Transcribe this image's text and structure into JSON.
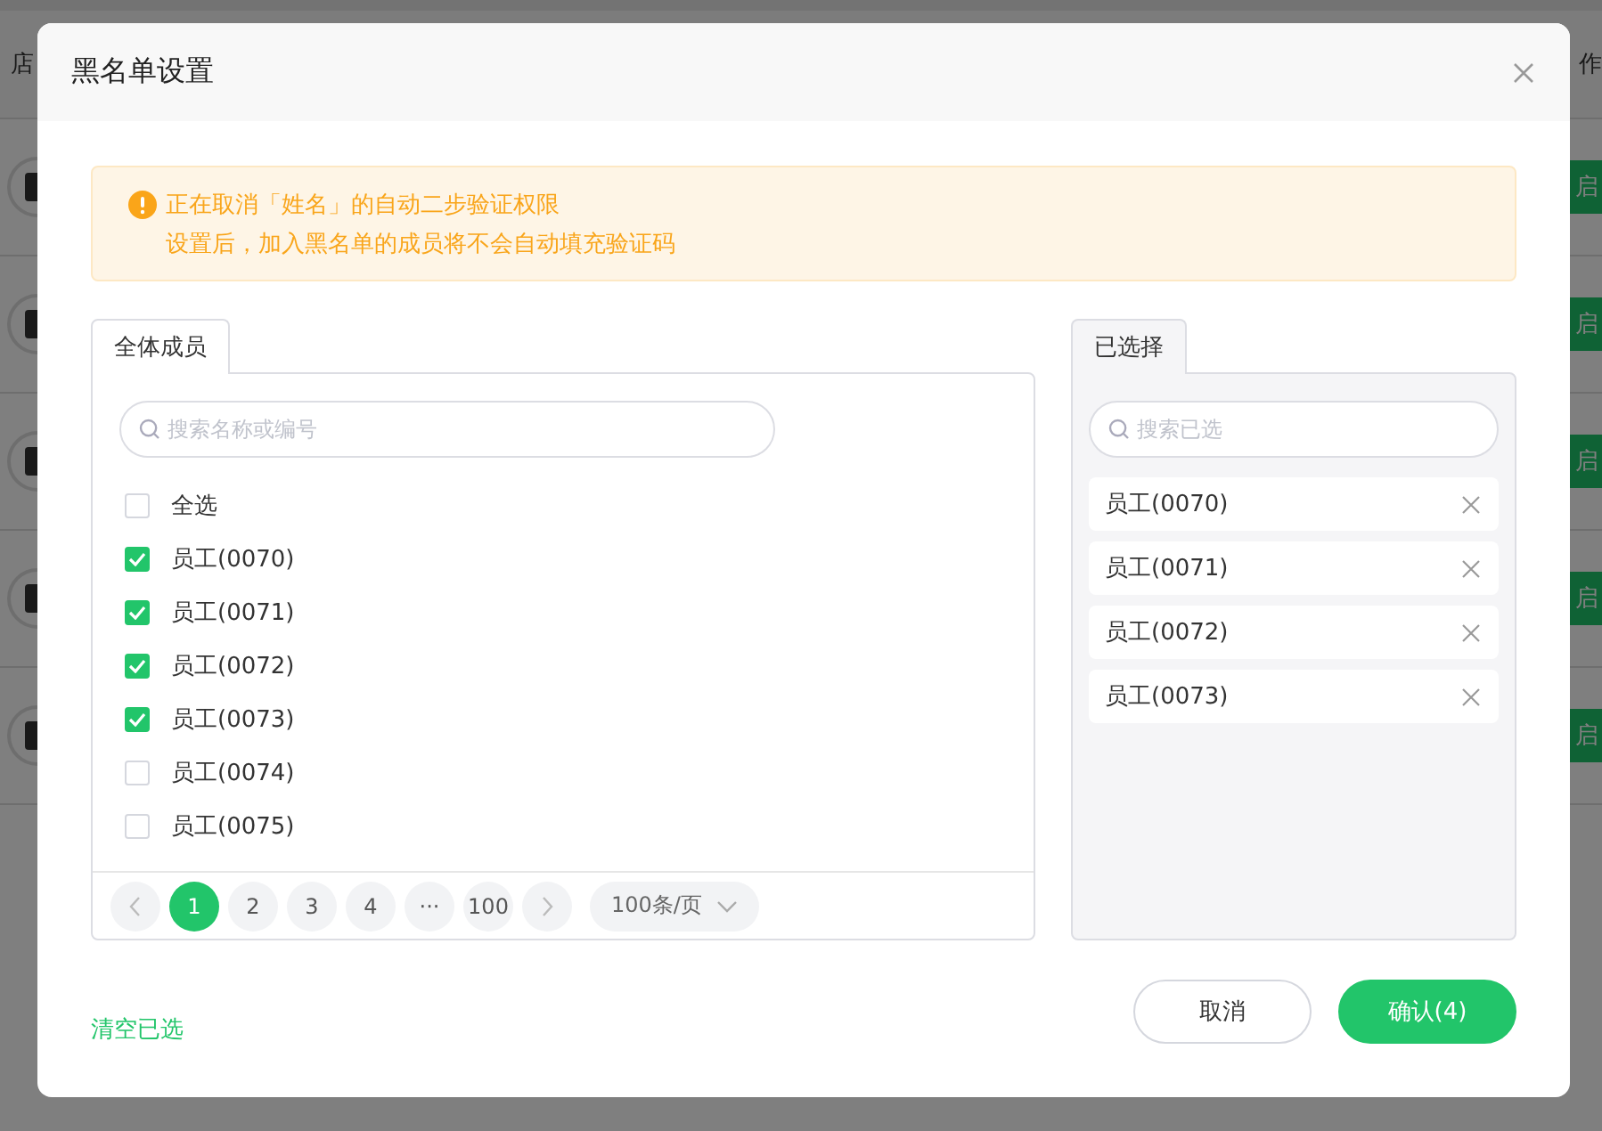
{
  "page": {
    "columns": [
      "店",
      "作"
    ],
    "rows": [
      {
        "action": "启"
      },
      {
        "action": "启"
      },
      {
        "action": "启"
      },
      {
        "action": "启"
      },
      {
        "action": "启"
      }
    ]
  },
  "dialog": {
    "title": "黑名单设置",
    "alert": {
      "title": "正在取消「姓名」的自动二步验证权限",
      "text": "设置后，加入黑名单的成员将不会自动填充验证码"
    },
    "left": {
      "tab": "全体成员",
      "search": {
        "placeholder": "搜索名称或编号"
      },
      "select_all": {
        "label": "全选",
        "checked": false
      },
      "members": [
        {
          "label": "员工(0070)",
          "checked": true
        },
        {
          "label": "员工(0071)",
          "checked": true
        },
        {
          "label": "员工(0072)",
          "checked": true
        },
        {
          "label": "员工(0073)",
          "checked": true
        },
        {
          "label": "员工(0074)",
          "checked": false
        },
        {
          "label": "员工(0075)",
          "checked": false
        }
      ],
      "pagination": {
        "pages": [
          {
            "label": "1",
            "selected": true
          },
          {
            "label": "2",
            "selected": false
          },
          {
            "label": "3",
            "selected": false
          },
          {
            "label": "4",
            "selected": false
          },
          {
            "label": "···",
            "selected": false
          },
          {
            "label": "100",
            "selected": false
          }
        ],
        "page_size": "100条/页"
      }
    },
    "right": {
      "tab": "已选择",
      "search": {
        "placeholder": "搜索已选"
      },
      "selected": [
        "员工(0070)",
        "员工(0071)",
        "员工(0072)",
        "员工(0073)"
      ]
    },
    "clear_link": "清空已选",
    "buttons": [
      {
        "label": "取消",
        "kind": "secondary"
      },
      {
        "label": "确认(4)",
        "kind": "primary"
      }
    ]
  }
}
